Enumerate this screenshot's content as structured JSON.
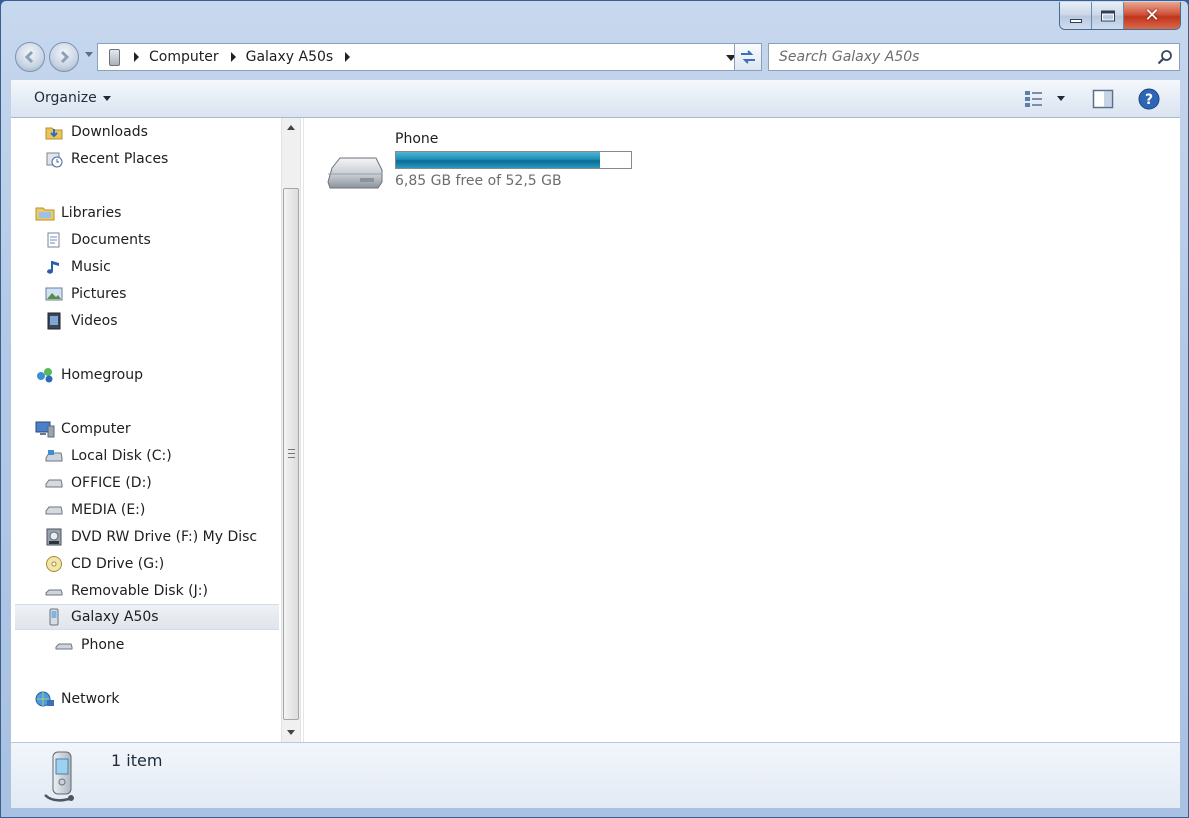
{
  "window": {
    "caption": {
      "minimize_icon": "minimize-icon",
      "maximize_icon": "maximize-icon",
      "close_icon": "close-icon",
      "close_glyph": "✕"
    }
  },
  "address": {
    "crumbs": [
      "Computer",
      "Galaxy A50s"
    ],
    "device_icon": "phone-icon"
  },
  "search": {
    "placeholder": "Search Galaxy A50s"
  },
  "toolbar": {
    "organize_label": "Organize"
  },
  "nav": {
    "favorites": [
      {
        "label": "Downloads",
        "icon": "downloads-folder-icon"
      },
      {
        "label": "Recent Places",
        "icon": "recent-places-icon"
      }
    ],
    "libraries": {
      "label": "Libraries",
      "items": [
        {
          "label": "Documents",
          "icon": "documents-icon"
        },
        {
          "label": "Music",
          "icon": "music-icon"
        },
        {
          "label": "Pictures",
          "icon": "pictures-icon"
        },
        {
          "label": "Videos",
          "icon": "videos-icon"
        }
      ]
    },
    "homegroup": {
      "label": "Homegroup",
      "icon": "homegroup-icon"
    },
    "computer": {
      "label": "Computer",
      "items": [
        {
          "label": "Local Disk (C:)",
          "icon": "local-disk-icon"
        },
        {
          "label": "OFFICE (D:)",
          "icon": "hard-drive-icon"
        },
        {
          "label": "MEDIA (E:)",
          "icon": "hard-drive-icon"
        },
        {
          "label": "DVD RW Drive (F:) My Disc",
          "icon": "dvd-drive-icon"
        },
        {
          "label": "CD Drive (G:)",
          "icon": "cd-drive-icon"
        },
        {
          "label": "Removable Disk (J:)",
          "icon": "removable-disk-icon"
        },
        {
          "label": "Galaxy A50s",
          "icon": "phone-icon",
          "selected": true
        }
      ],
      "sub_items": [
        {
          "label": "Phone",
          "icon": "phone-storage-icon"
        }
      ]
    },
    "network": {
      "label": "Network",
      "icon": "network-icon"
    }
  },
  "content": {
    "drives": [
      {
        "name": "Phone",
        "free_text": "6,85 GB free of 52,5 GB",
        "free_gb": 6.85,
        "total_gb": 52.5,
        "used_fraction": 0.8695
      }
    ]
  },
  "status": {
    "item_count": "1 item"
  },
  "colors": {
    "bar_fill": "#1e8fb7",
    "window_frame": "#b3c9e6",
    "close_button": "#c0351c"
  }
}
